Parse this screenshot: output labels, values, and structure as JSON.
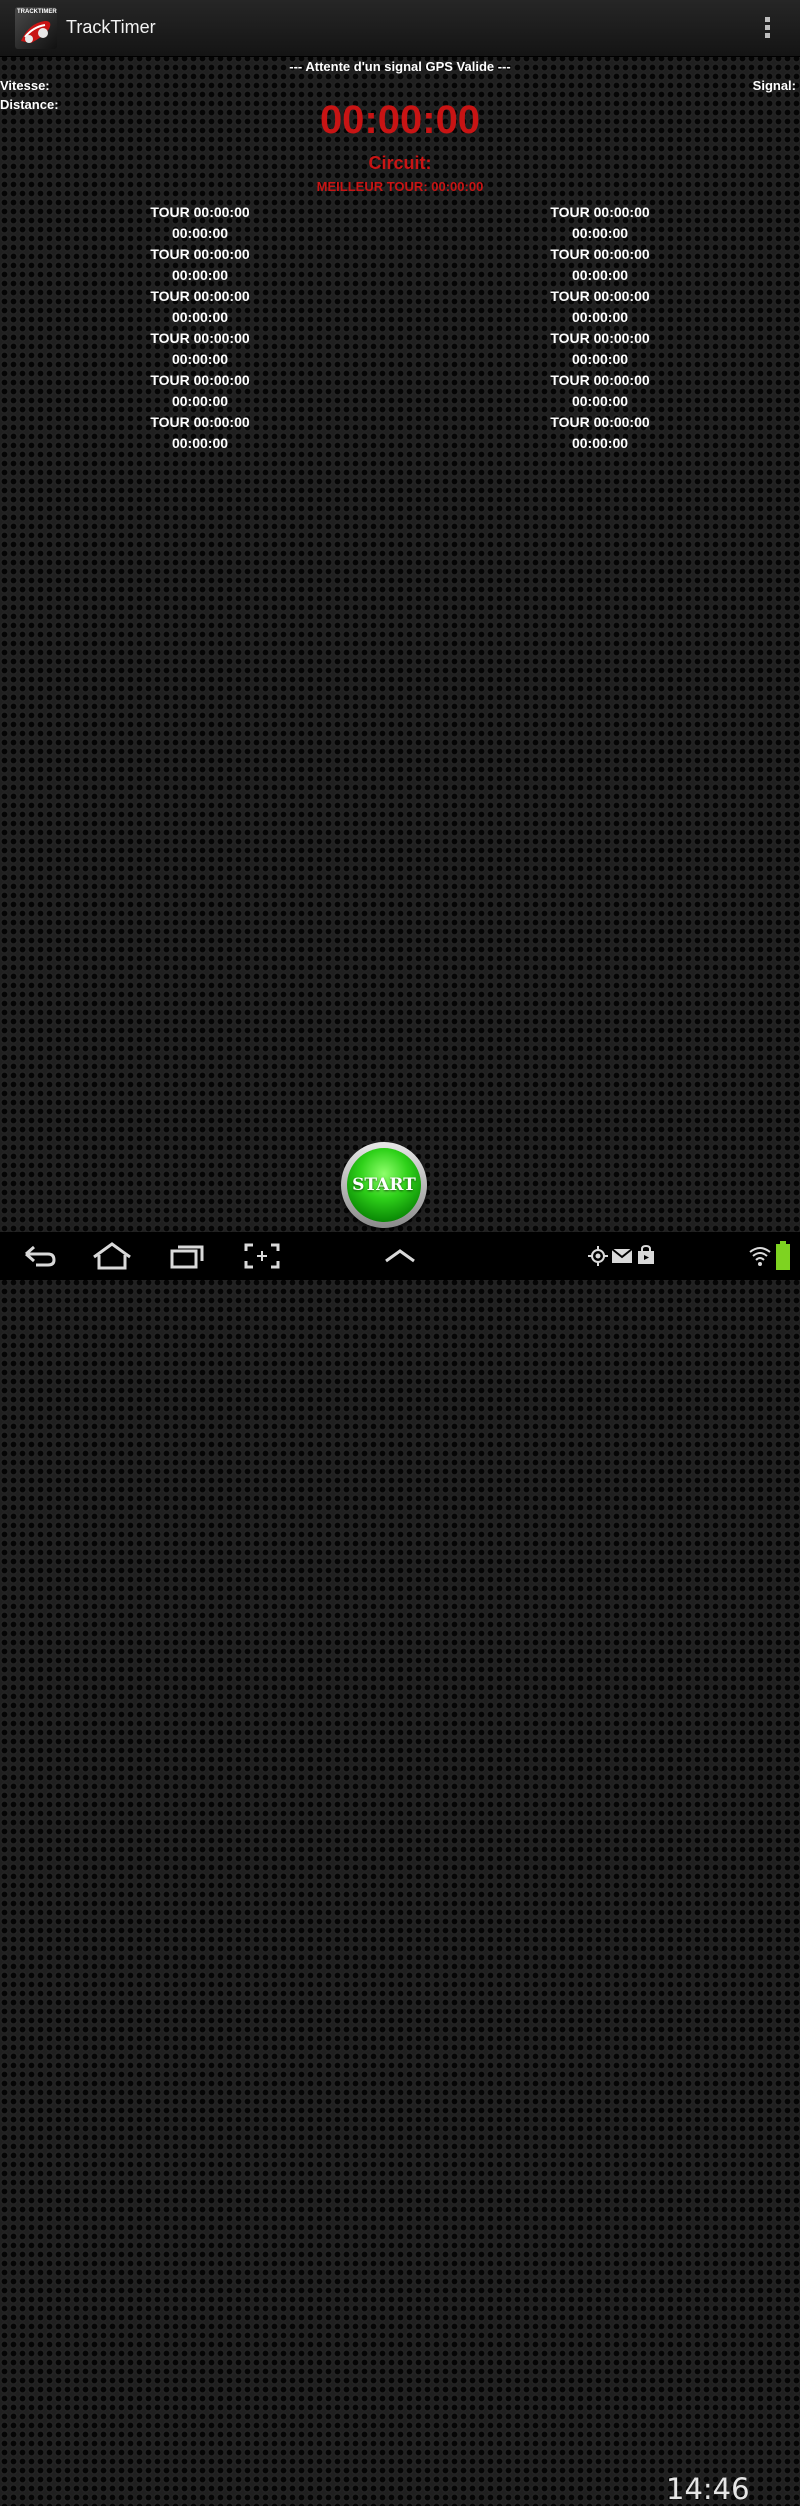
{
  "app": {
    "title": "TrackTimer",
    "icon_text": "TRACKTIMER"
  },
  "status": {
    "gps": "--- Attente d'un signal GPS Valide ---",
    "speed_label": "Vitesse:",
    "distance_label": "Distance:",
    "signal_label": "Signal:"
  },
  "timer": {
    "main": "00:00:00",
    "circuit_label": "Circuit:",
    "best_lap": "MEILLEUR TOUR: 00:00:00"
  },
  "laps_left": [
    {
      "tour": "TOUR 00:00:00",
      "time": "00:00:00"
    },
    {
      "tour": "TOUR 00:00:00",
      "time": "00:00:00"
    },
    {
      "tour": "TOUR 00:00:00",
      "time": "00:00:00"
    },
    {
      "tour": "TOUR 00:00:00",
      "time": "00:00:00"
    },
    {
      "tour": "TOUR 00:00:00",
      "time": "00:00:00"
    },
    {
      "tour": "TOUR 00:00:00",
      "time": "00:00:00"
    }
  ],
  "laps_right": [
    {
      "tour": "TOUR 00:00:00",
      "time": "00:00:00"
    },
    {
      "tour": "TOUR 00:00:00",
      "time": "00:00:00"
    },
    {
      "tour": "TOUR 00:00:00",
      "time": "00:00:00"
    },
    {
      "tour": "TOUR 00:00:00",
      "time": "00:00:00"
    },
    {
      "tour": "TOUR 00:00:00",
      "time": "00:00:00"
    },
    {
      "tour": "TOUR 00:00:00",
      "time": "00:00:00"
    }
  ],
  "start_button": {
    "label": "START"
  },
  "system_bar": {
    "clock": "14:46"
  },
  "icons": [
    "back-icon",
    "home-icon",
    "recent-apps-icon",
    "screenshot-icon",
    "chevron-up-icon",
    "gps-icon",
    "gmail-icon",
    "store-icon",
    "wifi-icon",
    "battery-icon",
    "overflow-menu-icon"
  ],
  "colors": {
    "timer_red": "#c81414",
    "start_green": "#2fd11a",
    "battery_green": "#7ed321"
  }
}
